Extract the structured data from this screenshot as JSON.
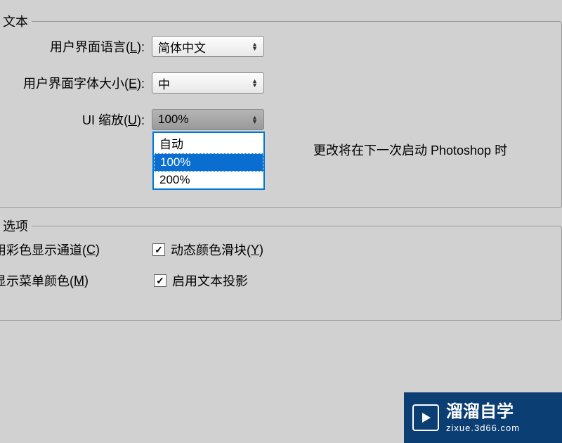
{
  "groups": {
    "text": {
      "title": "文本"
    },
    "options": {
      "title": "选项"
    }
  },
  "labels": {
    "ui_lang_pre": "用户界面语言(",
    "ui_lang_key": "L",
    "ui_font_pre": "用户界面字体大小(",
    "ui_font_key": "E",
    "ui_scale_pre": "UI 缩放(",
    "ui_scale_key": "U",
    "label_suffix": "):",
    "channel_pre": "用彩色显示通道(",
    "channel_key": "C",
    "channel_suf": ")",
    "menu_pre": "显示菜单颜色(",
    "menu_key": "M",
    "menu_suf": ")",
    "dynamic_pre": "动态颜色滑块(",
    "dynamic_key": "Y",
    "dynamic_suf": ")",
    "textshadow": "启用文本投影"
  },
  "values": {
    "ui_lang": "简体中文",
    "ui_font": "中",
    "ui_scale": "100%"
  },
  "scale_options": {
    "opt0": "自动",
    "opt1": "100%",
    "opt2": "200%"
  },
  "hint": "更改将在下一次启动 Photoshop 时",
  "checkmarks": {
    "dynamic": "✓",
    "textshadow": "✓"
  },
  "watermark": {
    "title": "溜溜自学",
    "url": "zixue.3d66.com"
  }
}
